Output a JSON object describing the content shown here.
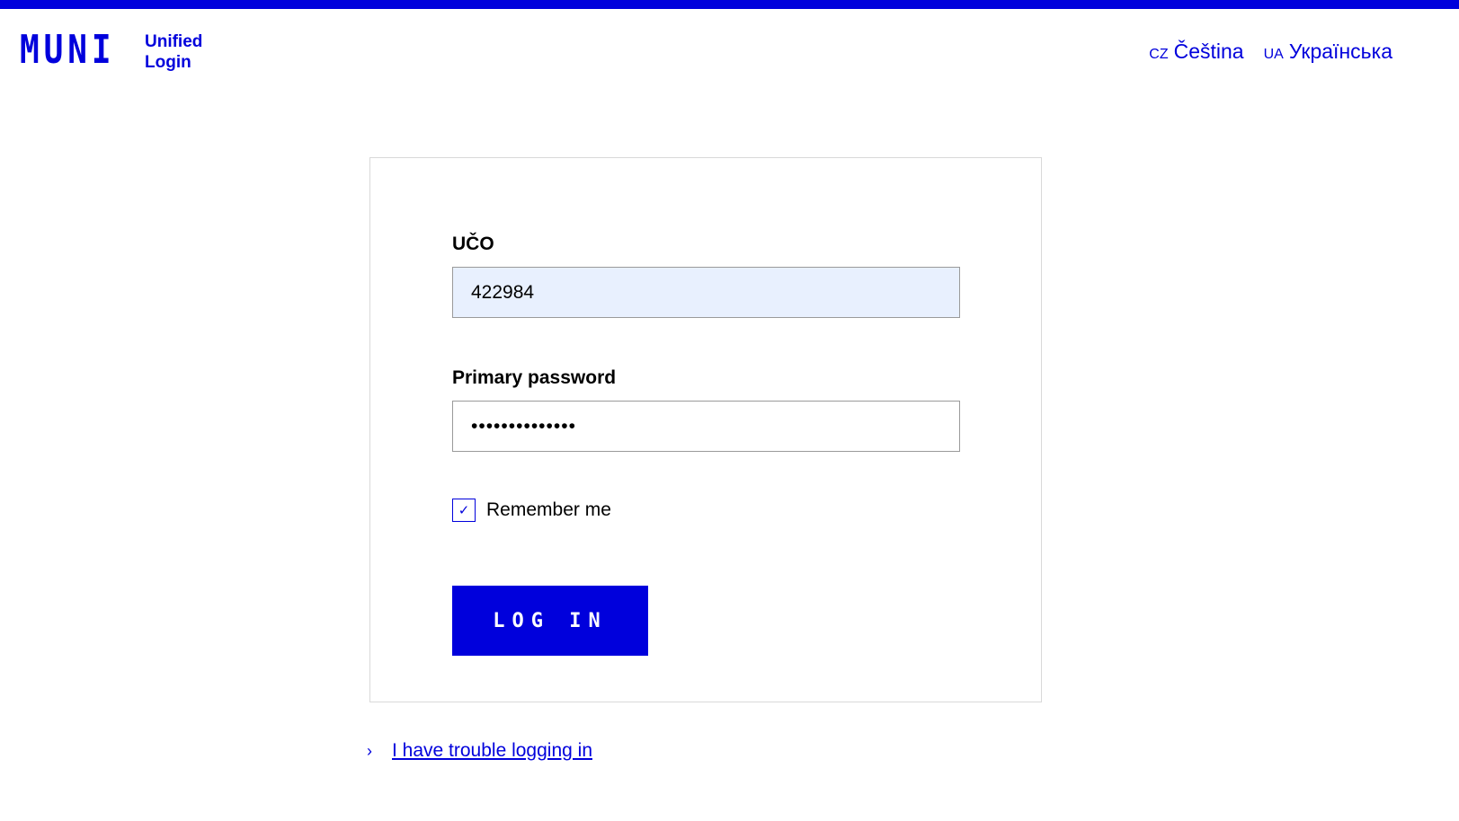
{
  "header": {
    "logo_mark": "MUNI",
    "logo_line1": "Unified",
    "logo_line2": "Login",
    "languages": [
      {
        "code": "cz",
        "label": "Čeština"
      },
      {
        "code": "ua",
        "label": "Українська"
      }
    ]
  },
  "form": {
    "uco_label": "UČO",
    "uco_value": "422984",
    "password_label": "Primary password",
    "password_value": "••••••••••••••",
    "remember_label": "Remember me",
    "remember_checked": true,
    "checkmark": "✓",
    "login_button": "LOG IN"
  },
  "help": {
    "chevron": "›",
    "trouble_link": "I have trouble logging in"
  },
  "colors": {
    "brand": "#0000dc",
    "autofill_bg": "#e8f0fe"
  }
}
